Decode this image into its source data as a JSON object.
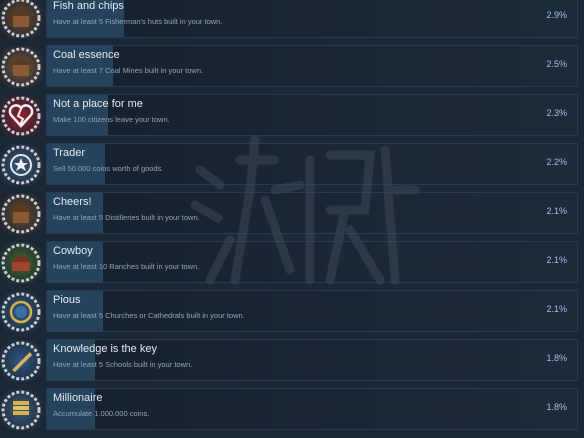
{
  "achievements": [
    {
      "title": "Fish and chips",
      "description": "Have at least 5 Fisherman's huts built in your town.",
      "percent": "2.9%",
      "percent_value": 2.9,
      "icon": "fisherman-hut-icon",
      "tint": "#6b4a2c"
    },
    {
      "title": "Coal essence",
      "description": "Have at least 7 Coal Mines built in your town.",
      "percent": "2.5%",
      "percent_value": 2.5,
      "icon": "coal-mine-icon",
      "tint": "#7a5634"
    },
    {
      "title": "Not a place for me",
      "description": "Make 100 citizens leave your town.",
      "percent": "2.3%",
      "percent_value": 2.3,
      "icon": "broken-heart-icon",
      "tint": "#9b1c2a"
    },
    {
      "title": "Trader",
      "description": "Sell 50.000 coins worth of goods.",
      "percent": "2.2%",
      "percent_value": 2.2,
      "icon": "star-coin-icon",
      "tint": "#3a5c7e"
    },
    {
      "title": "Cheers!",
      "description": "Have at least 5 Distilleries built in your town.",
      "percent": "2.1%",
      "percent_value": 2.1,
      "icon": "distillery-icon",
      "tint": "#6b4a2c"
    },
    {
      "title": "Cowboy",
      "description": "Have at least 10 Ranches built in your town.",
      "percent": "2.1%",
      "percent_value": 2.1,
      "icon": "ranch-icon",
      "tint": "#3f6b2a"
    },
    {
      "title": "Pious",
      "description": "Have at least 5 Churches or Cathedrals built in your town.",
      "percent": "2.1%",
      "percent_value": 2.1,
      "icon": "church-icon",
      "tint": "#2f5a86"
    },
    {
      "title": "Knowledge is the key",
      "description": "Have at least 5 Schools built in your town.",
      "percent": "1.8%",
      "percent_value": 1.8,
      "icon": "school-quill-icon",
      "tint": "#2f5a86"
    },
    {
      "title": "Millionaire",
      "description": "Accumulate 1.000.000 coins.",
      "percent": "1.8%",
      "percent_value": 1.8,
      "icon": "coin-stack-icon",
      "tint": "#3a5c7e"
    }
  ],
  "colors": {
    "background": "#1b2838",
    "bar": "#26435e",
    "percent_text": "#9fc3e4"
  }
}
